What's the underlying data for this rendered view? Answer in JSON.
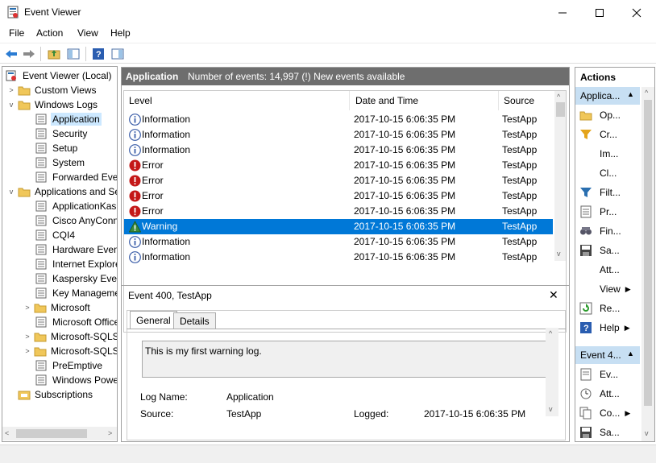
{
  "window": {
    "title": "Event Viewer"
  },
  "menu": [
    "File",
    "Action",
    "View",
    "Help"
  ],
  "tree": {
    "root": "Event Viewer (Local)",
    "custom_views": "Custom Views",
    "windows_logs": "Windows Logs",
    "windows_logs_children": [
      "Application",
      "Security",
      "Setup",
      "System",
      "Forwarded Events"
    ],
    "apps_services": "Applications and Services Logs",
    "apps_children": [
      "ApplicationKaspersky",
      "Cisco AnyConnect",
      "CQI4",
      "Hardware Events",
      "Internet Explorer",
      "Kaspersky Events",
      "Key Management",
      "Microsoft",
      "Microsoft Office",
      "Microsoft-SQLServer",
      "Microsoft-SQLServer",
      "PreEmptive",
      "Windows PowerShell"
    ],
    "subscriptions": "Subscriptions"
  },
  "log": {
    "name": "Application",
    "summary": "Number of events: 14,997 (!) New events available",
    "columns": [
      "Level",
      "Date and Time",
      "Source"
    ],
    "rows": [
      {
        "level": "Information",
        "date": "2017-10-15 6:06:35 PM",
        "source": "TestApp",
        "icon": "info"
      },
      {
        "level": "Information",
        "date": "2017-10-15 6:06:35 PM",
        "source": "TestApp",
        "icon": "info"
      },
      {
        "level": "Information",
        "date": "2017-10-15 6:06:35 PM",
        "source": "TestApp",
        "icon": "info"
      },
      {
        "level": "Error",
        "date": "2017-10-15 6:06:35 PM",
        "source": "TestApp",
        "icon": "error"
      },
      {
        "level": "Error",
        "date": "2017-10-15 6:06:35 PM",
        "source": "TestApp",
        "icon": "error"
      },
      {
        "level": "Error",
        "date": "2017-10-15 6:06:35 PM",
        "source": "TestApp",
        "icon": "error"
      },
      {
        "level": "Error",
        "date": "2017-10-15 6:06:35 PM",
        "source": "TestApp",
        "icon": "error"
      },
      {
        "level": "Warning",
        "date": "2017-10-15 6:06:35 PM",
        "source": "TestApp",
        "icon": "warning",
        "selected": true
      },
      {
        "level": "Information",
        "date": "2017-10-15 6:06:35 PM",
        "source": "TestApp",
        "icon": "info"
      },
      {
        "level": "Information",
        "date": "2017-10-15 6:06:35 PM",
        "source": "TestApp",
        "icon": "info"
      }
    ]
  },
  "detail": {
    "title": "Event 400, TestApp",
    "tabs": [
      "General",
      "Details"
    ],
    "message": "This is my first warning log.",
    "log_name_label": "Log Name:",
    "log_name_value": "Application",
    "source_label": "Source:",
    "source_value": "TestApp",
    "logged_label": "Logged:",
    "logged_value": "2017-10-15 6:06:35 PM"
  },
  "actions": {
    "header": "Actions",
    "section1": "Applica...",
    "items1": [
      "Op...",
      "Cr...",
      "Im...",
      "Cl...",
      "Filt...",
      "Pr...",
      "Fin...",
      "Sa...",
      "Att...",
      "View",
      "Re...",
      "Help"
    ],
    "section2": "Event 4...",
    "items2": [
      "Ev...",
      "Att...",
      "Co...",
      "Sa..."
    ]
  },
  "colors": {
    "accent": "#0078d7",
    "selection_light": "#cce8ff",
    "header_gray": "#6e6e6e",
    "section_blue": "#c7dff3"
  }
}
